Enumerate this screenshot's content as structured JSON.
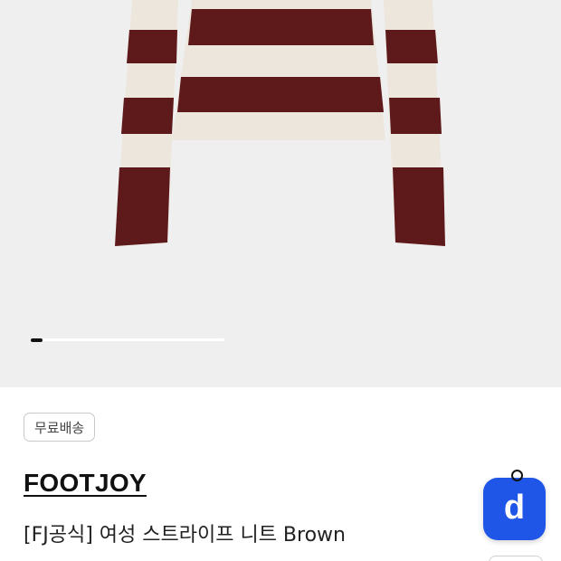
{
  "colors": {
    "image_background": "#efefef",
    "stripe_dark": "#5e1a1a",
    "stripe_light": "#ece6dd",
    "accent_blue": "#1f56e8"
  },
  "carousel": {
    "current": 1,
    "progress_fraction": 0.06
  },
  "product": {
    "shipping_badge": "무료배송",
    "brand": "FOOTJOY",
    "title": "[FJ공식] 여성 스트라이프 니트 Brown"
  },
  "floating_button": {
    "icon": "app-logo-d-icon",
    "letter": "d"
  }
}
